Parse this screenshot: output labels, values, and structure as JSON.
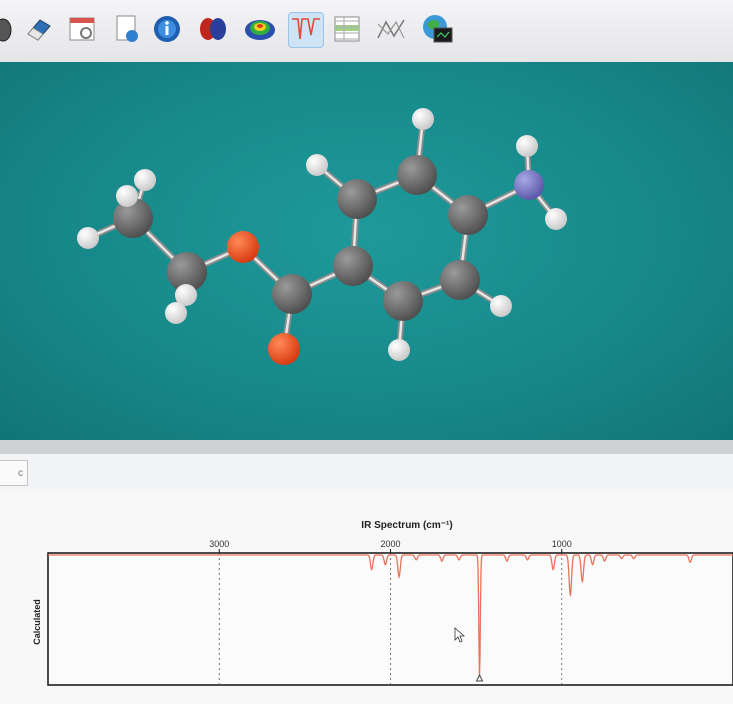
{
  "toolbar": {
    "buttons": [
      {
        "name": "mouse-icon",
        "active": false
      },
      {
        "name": "eraser-icon",
        "active": false
      },
      {
        "name": "calendar-settings-icon",
        "active": false
      },
      {
        "name": "document-info-icon",
        "active": false
      },
      {
        "name": "info-icon",
        "active": false
      },
      {
        "name": "orbital-icon",
        "active": false
      },
      {
        "name": "electron-density-icon",
        "active": false
      },
      {
        "name": "spectrum-icon",
        "active": true
      },
      {
        "name": "table-icon",
        "active": false
      },
      {
        "name": "geometry-icon",
        "active": false
      },
      {
        "name": "globe-terminal-icon",
        "active": false
      }
    ]
  },
  "molecule": {
    "colors": {
      "carbon": "#4f4f4f",
      "oxygen": "#d83a12",
      "nitrogen": "#5a58a8",
      "hydrogen": "#f2f2f2",
      "background": "#178788"
    }
  },
  "panel": {
    "tab_label": "c"
  },
  "chart_data": {
    "type": "line",
    "title": "IR Spectrum (cm⁻¹)",
    "xlabel": "",
    "ylabel": "Calculated",
    "x_reversed": true,
    "xlim": [
      4000,
      0
    ],
    "x_ticks": [
      3000,
      2000,
      1000
    ],
    "x_tick_labels": [
      "3000",
      "2000",
      "1000"
    ],
    "ylim": [
      0,
      1
    ],
    "grid": "vertical dashed at ticks",
    "line_color": "#e8735a",
    "series": [
      {
        "peaks": [
          {
            "x": 2110,
            "depth": 0.12
          },
          {
            "x": 2030,
            "depth": 0.08
          },
          {
            "x": 1950,
            "depth": 0.18
          },
          {
            "x": 1850,
            "depth": 0.04
          },
          {
            "x": 1700,
            "depth": 0.05
          },
          {
            "x": 1600,
            "depth": 0.04
          },
          {
            "x": 1480,
            "depth": 1.0
          },
          {
            "x": 1320,
            "depth": 0.05
          },
          {
            "x": 1200,
            "depth": 0.04
          },
          {
            "x": 1050,
            "depth": 0.12
          },
          {
            "x": 950,
            "depth": 0.33
          },
          {
            "x": 880,
            "depth": 0.22
          },
          {
            "x": 820,
            "depth": 0.08
          },
          {
            "x": 750,
            "depth": 0.05
          },
          {
            "x": 650,
            "depth": 0.03
          },
          {
            "x": 580,
            "depth": 0.03
          },
          {
            "x": 250,
            "depth": 0.06
          }
        ]
      }
    ]
  }
}
